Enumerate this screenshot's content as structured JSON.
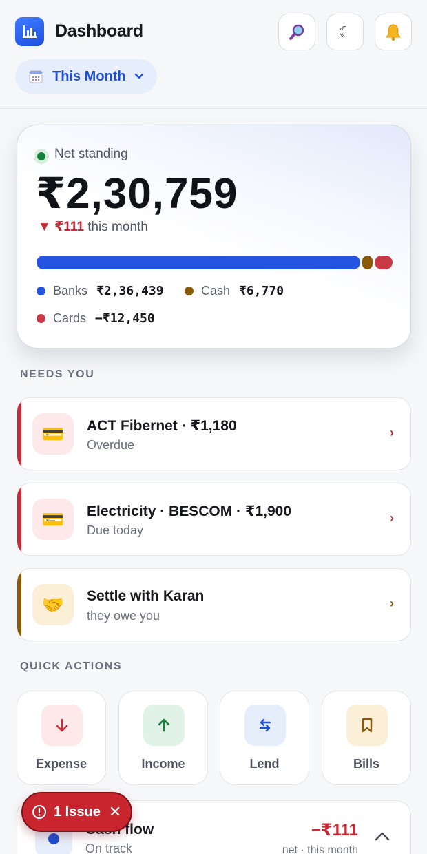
{
  "header": {
    "title": "Dashboard",
    "period_label": "This Month"
  },
  "net": {
    "label": "Net standing",
    "amount": "₹2,30,759",
    "change_value": "▼ ₹111",
    "change_suffix": "this month",
    "bar_shares": {
      "banks": 0.92,
      "cash": 0.029,
      "cards": 0.051
    },
    "legend": [
      {
        "label": "Banks",
        "value": "₹2,36,439",
        "color": "#2554e0"
      },
      {
        "label": "Cash",
        "value": "₹6,770",
        "color": "#8a5a0b"
      },
      {
        "label": "Cards",
        "value": "−₹12,450",
        "color": "#c83a44"
      }
    ]
  },
  "needs_you": {
    "title": "NEEDS YOU",
    "items": [
      {
        "title": "ACT Fibernet · ₹1,180",
        "subtitle": "Overdue",
        "icon": "credit-card-icon",
        "accent": "#c42b36"
      },
      {
        "title": "Electricity · BESCOM · ₹1,900",
        "subtitle": "Due today",
        "icon": "credit-card-icon",
        "accent": "#c42b36"
      },
      {
        "title": "Settle with Karan",
        "subtitle": "they owe you",
        "icon": "handshake-icon",
        "accent": "#8a5a0b"
      }
    ]
  },
  "quick_actions": {
    "title": "QUICK ACTIONS",
    "items": [
      {
        "label": "Expense",
        "icon": "arrow-down-icon",
        "color": "#c42b36",
        "bg": "#fde8ea"
      },
      {
        "label": "Income",
        "icon": "arrow-up-icon",
        "color": "#15803d",
        "bg": "#e1f3e6"
      },
      {
        "label": "Lend",
        "icon": "swap-icon",
        "color": "#1f4fd6",
        "bg": "#e7eefb"
      },
      {
        "label": "Bills",
        "icon": "bookmark-icon",
        "color": "#8a5a0b",
        "bg": "#fbefd8"
      }
    ]
  },
  "cashflow": {
    "title": "Cash flow",
    "subtitle": "On track",
    "amount": "−₹111",
    "note": "net · this month"
  },
  "issue_badge": {
    "label": "1 Issue"
  }
}
